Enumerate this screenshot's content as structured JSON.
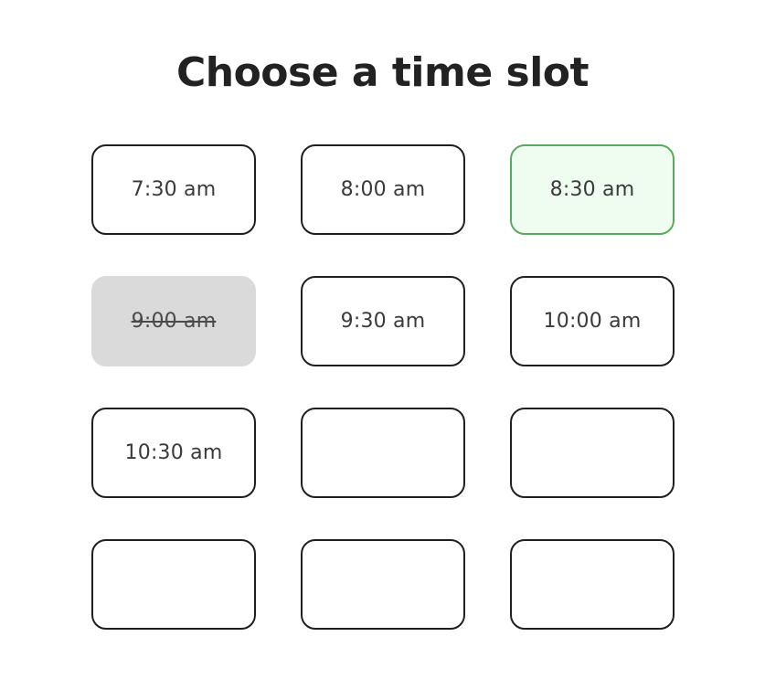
{
  "title": "Choose a time slot",
  "slots": [
    {
      "label": "7:30 am",
      "state": "available"
    },
    {
      "label": "8:00 am",
      "state": "available"
    },
    {
      "label": "8:30 am",
      "state": "selected"
    },
    {
      "label": "9:00 am",
      "state": "unavailable"
    },
    {
      "label": "9:30 am",
      "state": "available"
    },
    {
      "label": "10:00 am",
      "state": "available"
    },
    {
      "label": "10:30 am",
      "state": "available"
    },
    {
      "label": "",
      "state": "empty"
    },
    {
      "label": "",
      "state": "empty"
    },
    {
      "label": "",
      "state": "empty"
    },
    {
      "label": "",
      "state": "empty"
    },
    {
      "label": "",
      "state": "empty"
    }
  ],
  "colors": {
    "selected_background": "#effdf1",
    "selected_border": "#5aa95f",
    "unavailable_background": "#dadada",
    "border": "#1f1f1f",
    "title": "#222222"
  }
}
